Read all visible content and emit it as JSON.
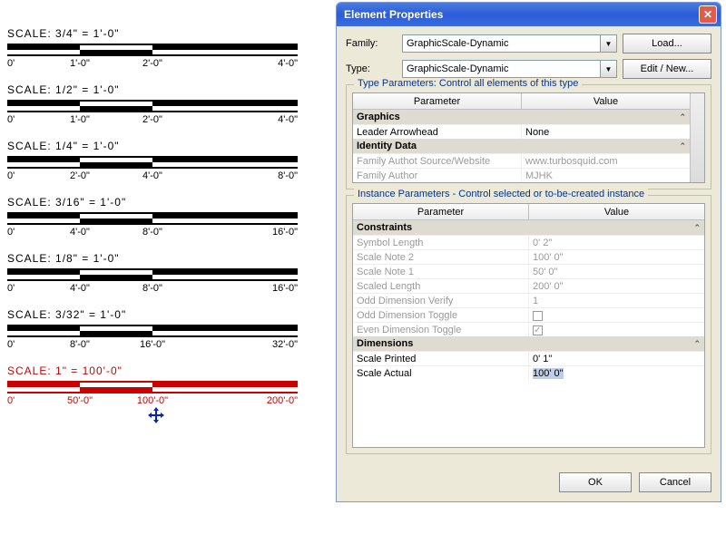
{
  "scales": [
    {
      "label": "SCALE: 3/4\" = 1'-0\"",
      "ticks": [
        "0'",
        "1'-0\"",
        "2'-0\"",
        "4'-0\""
      ],
      "red": false
    },
    {
      "label": "SCALE: 1/2\" = 1'-0\"",
      "ticks": [
        "0'",
        "1'-0\"",
        "2'-0\"",
        "4'-0\""
      ],
      "red": false
    },
    {
      "label": "SCALE: 1/4\" = 1'-0\"",
      "ticks": [
        "0'",
        "2'-0\"",
        "4'-0\"",
        "8'-0\""
      ],
      "red": false
    },
    {
      "label": "SCALE: 3/16\" = 1'-0\"",
      "ticks": [
        "0'",
        "4'-0\"",
        "8'-0\"",
        "16'-0\""
      ],
      "red": false
    },
    {
      "label": "SCALE: 1/8\" = 1'-0\"",
      "ticks": [
        "0'",
        "4'-0\"",
        "8'-0\"",
        "16'-0\""
      ],
      "red": false
    },
    {
      "label": "SCALE: 3/32\" = 1'-0\"",
      "ticks": [
        "0'",
        "8'-0\"",
        "16'-0\"",
        "32'-0\""
      ],
      "red": false
    },
    {
      "label": "SCALE: 1\" = 100'-0\"",
      "ticks": [
        "0'",
        "50'-0\"",
        "100'-0\"",
        "200'-0\""
      ],
      "red": true
    }
  ],
  "dialog": {
    "title": "Element Properties",
    "family_label": "Family:",
    "type_label": "Type:",
    "family_value": "GraphicScale-Dynamic",
    "type_value": "GraphicScale-Dynamic",
    "load_btn": "Load...",
    "edit_btn": "Edit / New...",
    "type_group": "Type Parameters: Control all elements of this type",
    "inst_group": "Instance Parameters - Control selected or to-be-created instance",
    "col_param": "Parameter",
    "col_value": "Value",
    "type_sections": {
      "graphics": "Graphics",
      "identity": "Identity Data"
    },
    "type_rows": {
      "leader": {
        "p": "Leader Arrowhead",
        "v": "None"
      },
      "src": {
        "p": "Family Authot Source/Website",
        "v": "www.turbosquid.com"
      },
      "auth": {
        "p": "Family Author",
        "v": "MJHK"
      }
    },
    "inst_sections": {
      "constraints": "Constraints",
      "dimensions": "Dimensions"
    },
    "inst_rows": {
      "symlen": {
        "p": "Symbol Length",
        "v": "0'  2\""
      },
      "sn2": {
        "p": "Scale Note 2",
        "v": "100'  0\""
      },
      "sn1": {
        "p": "Scale Note 1",
        "v": "50'  0\""
      },
      "sclen": {
        "p": "Scaled Length",
        "v": "200'  0\""
      },
      "odv": {
        "p": "Odd Dimension Verify",
        "v": "1"
      },
      "odt": {
        "p": "Odd Dimension Toggle",
        "v": ""
      },
      "edt": {
        "p": "Even Dimension Toggle",
        "v": ""
      },
      "sp": {
        "p": "Scale Printed",
        "v": "0'  1\""
      },
      "sa": {
        "p": "Scale Actual",
        "v": "100'  0\""
      }
    },
    "ok": "OK",
    "cancel": "Cancel"
  }
}
